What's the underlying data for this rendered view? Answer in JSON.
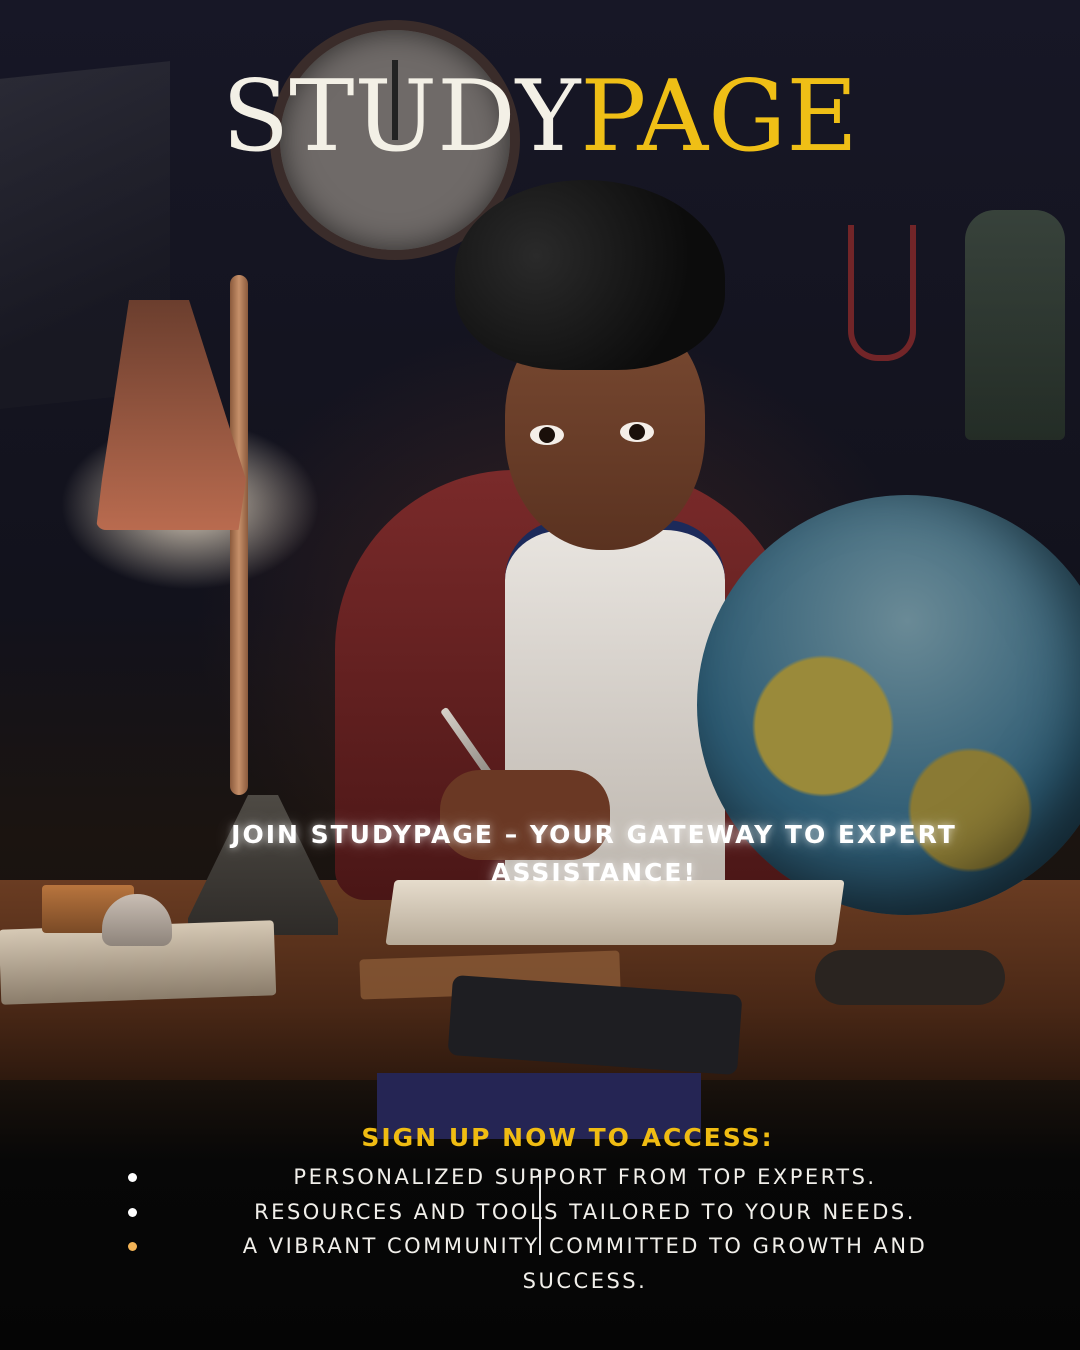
{
  "brand": {
    "part1": "STUDY",
    "part2": "PAGE",
    "part1_color": "#f3f0e6",
    "part2_color": "#efbf16"
  },
  "headline": "JOIN STUDYPAGE – YOUR GATEWAY TO EXPERT ASSISTANCE!",
  "signup": {
    "heading": "SIGN UP NOW TO ACCESS:",
    "heading_color": "#f0bc12",
    "benefits": [
      "PERSONALIZED SUPPORT FROM TOP EXPERTS.",
      "RESOURCES AND TOOLS TAILORED TO YOUR NEEDS.",
      "A VIBRANT COMMUNITY COMMITTED TO GROWTH AND SUCCESS."
    ]
  },
  "colors": {
    "background": "#0f0f16",
    "cta_block": "#252554",
    "bullet_accent": "#f2b356"
  },
  "illustration_icons": [
    "wall-clock-icon",
    "desk-lamp-icon",
    "globe-icon"
  ]
}
